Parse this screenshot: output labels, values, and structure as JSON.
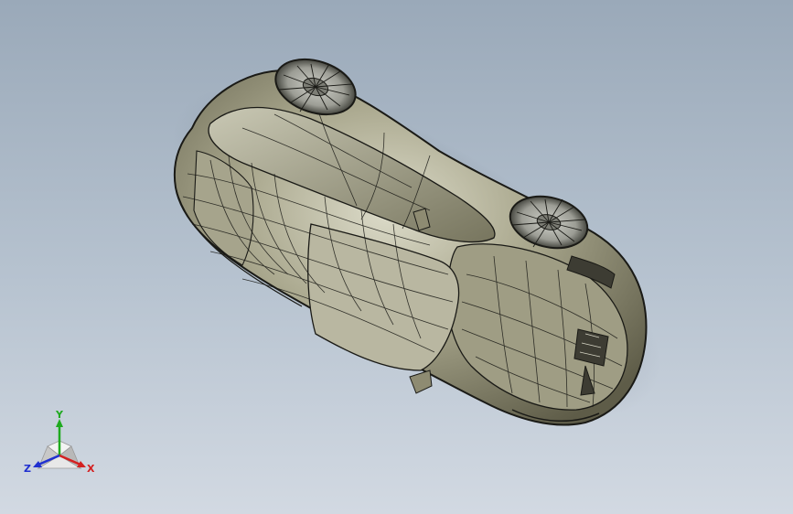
{
  "viewport": {
    "background_top": "#9aa9b9",
    "background_bottom": "#d2d9e2"
  },
  "model": {
    "body_color": "#8e8b72",
    "body_highlight": "#d9d8c6",
    "edge_color": "#1a1a16"
  },
  "triad": {
    "x_label": "X",
    "y_label": "Y",
    "z_label": "Z",
    "x_color": "#d42020",
    "y_color": "#1faa1f",
    "z_color": "#2030d0"
  }
}
